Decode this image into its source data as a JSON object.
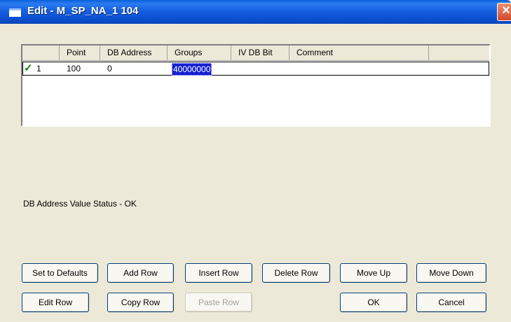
{
  "window": {
    "title": "Edit - M_SP_NA_1 104",
    "close_glyph": "✕"
  },
  "grid": {
    "columns": [
      "Point",
      "DB Address",
      "Groups",
      "IV DB Bit",
      "Comment"
    ],
    "rows": [
      {
        "index": "1",
        "status_icon": "check-icon",
        "point": "100",
        "db_address": "0",
        "groups": "40000000",
        "iv_db_bit": "",
        "comment": ""
      }
    ]
  },
  "status_text": "DB Address Value Status - OK",
  "buttons": {
    "set_to_defaults": "Set to Defaults",
    "add_row": "Add Row",
    "insert_row": "Insert Row",
    "delete_row": "Delete Row",
    "move_up": "Move Up",
    "move_down": "Move Down",
    "edit_row": "Edit Row",
    "copy_row": "Copy Row",
    "paste_row": "Paste Row",
    "ok": "OK",
    "cancel": "Cancel"
  },
  "colors": {
    "title_bar": "#1660e0",
    "selection": "#1420d0",
    "check": "#108010"
  }
}
